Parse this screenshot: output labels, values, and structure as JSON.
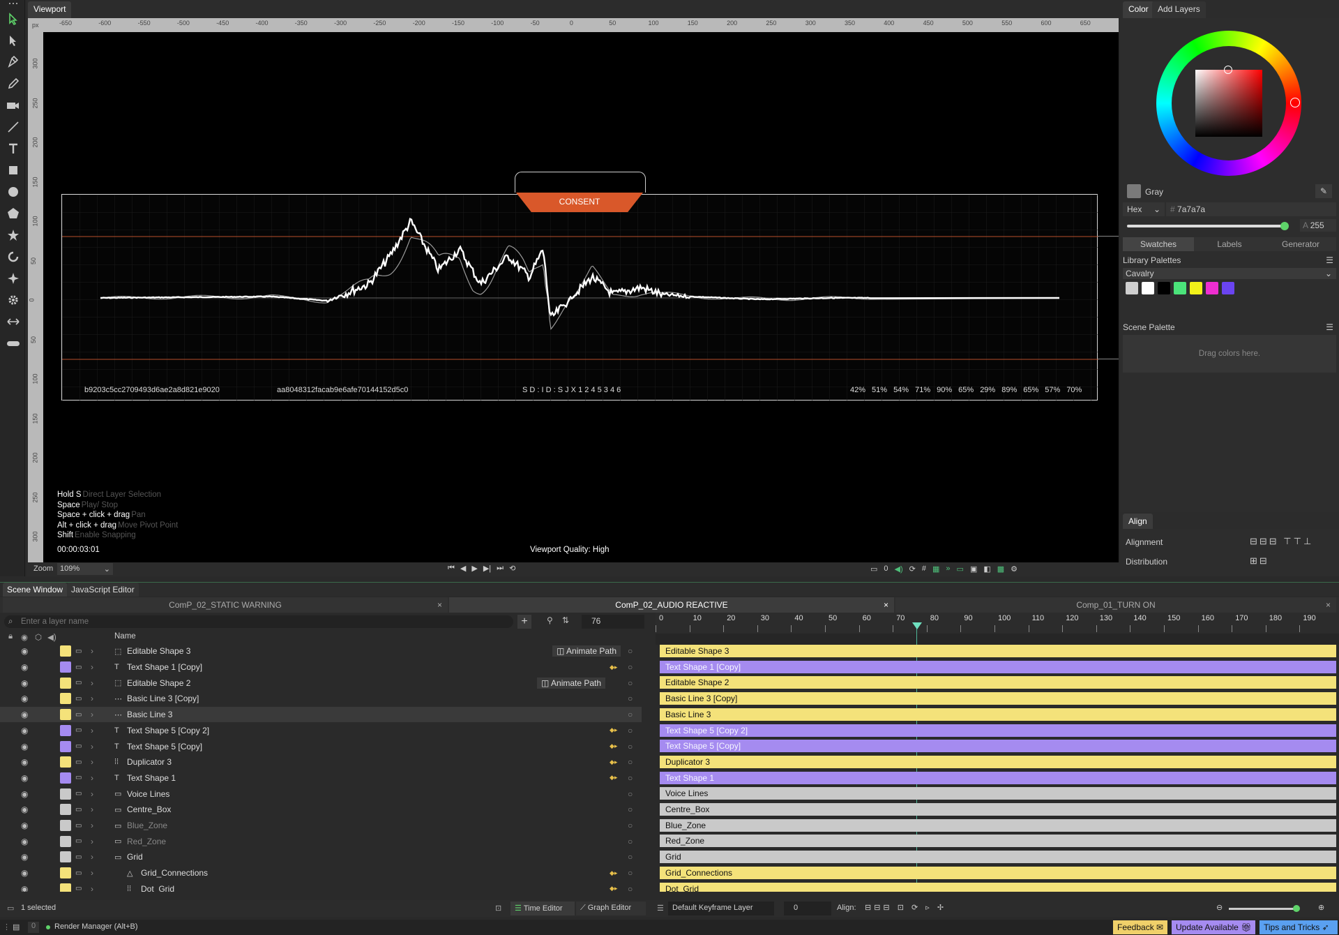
{
  "viewport": {
    "tab": "Viewport",
    "unit": "px",
    "ruler_h": [
      "-650",
      "-600",
      "-550",
      "-500",
      "-450",
      "-400",
      "-350",
      "-300",
      "-250",
      "-200",
      "-150",
      "-100",
      "-50",
      "0",
      "50",
      "100",
      "150",
      "200",
      "250",
      "300",
      "350",
      "400",
      "450",
      "500",
      "550",
      "600",
      "650"
    ],
    "ruler_v": [
      "300",
      "250",
      "200",
      "150",
      "100",
      "50",
      "0",
      "50",
      "100",
      "150",
      "200",
      "250",
      "300"
    ],
    "consent_label": "CONSENT",
    "hash_1": "b9203c5cc2709493d6ae2a8d821e9020",
    "hash_2": "aa8048312facab9e6afe70144152d5c0",
    "sd_id": "S D : I D : S J X 1 2 4 5 3 4 6",
    "percentages": [
      "42%",
      "51%",
      "54%",
      "71%",
      "90%",
      "65%",
      "29%",
      "89%",
      "65%",
      "57%",
      "70%"
    ],
    "hints": [
      {
        "key": "Hold S",
        "desc": "Direct Layer Selection"
      },
      {
        "key": "Space",
        "desc": "Play/ Stop"
      },
      {
        "key": "Space + click + drag",
        "desc": "Pan"
      },
      {
        "key": "Alt + click + drag",
        "desc": "Move Pivot Point"
      },
      {
        "key": "Shift",
        "desc": "Enable Snapping"
      }
    ],
    "timecode": "00:00:03:01",
    "quality": "Viewport Quality: High",
    "zoom_label": "Zoom",
    "zoom_value": "109%",
    "frame_value": "0"
  },
  "color_panel": {
    "tabs": [
      "Color",
      "Add Layers"
    ],
    "color_name": "Gray",
    "hex_label": "Hex",
    "hex_value": "7a7a7a",
    "hex_prefix": "#",
    "alpha_label": "A",
    "alpha_value": "255",
    "subtabs": [
      "Swatches",
      "Labels",
      "Generator"
    ],
    "library_palettes": "Library Palettes",
    "palette_name": "Cavalry",
    "swatch_colors": [
      "#cfcfcf",
      "#ffffff",
      "#000000",
      "#4be37a",
      "#f2f21a",
      "#ee2ed0",
      "#6a44f0"
    ],
    "scene_palette": "Scene Palette",
    "drag_hint": "Drag colors here.",
    "accent": "#e85f2c"
  },
  "align_panel": {
    "tab": "Align",
    "alignment": "Alignment",
    "distribution": "Distribution"
  },
  "bottom": {
    "tabs": [
      "Scene Window",
      "JavaScript Editor"
    ],
    "comp_tabs": [
      "ComP_02_STATIC WARNING",
      "ComP_02_AUDIO REACTIVE",
      "Comp_01_TURN ON"
    ],
    "search_placeholder": "Enter a layer name",
    "frame_field": "76",
    "name_header": "Name",
    "timeline_ticks": [
      "0",
      "10",
      "20",
      "30",
      "40",
      "50",
      "60",
      "70",
      "80",
      "90",
      "100",
      "110",
      "120",
      "130",
      "140",
      "150",
      "160",
      "170",
      "180",
      "190"
    ],
    "animate_path": "Animate Path",
    "layers": [
      {
        "name": "Editable Shape 3",
        "color": "y",
        "icon": "shape",
        "extra": "Animate Path"
      },
      {
        "name": "Text Shape 1 [Copy]",
        "color": "p",
        "icon": "text"
      },
      {
        "name": "Editable Shape 2",
        "color": "y",
        "icon": "shape",
        "extra": "Animate Path"
      },
      {
        "name": "Basic Line 3 [Copy]",
        "color": "y",
        "icon": "line"
      },
      {
        "name": "Basic Line 3",
        "color": "y",
        "icon": "line"
      },
      {
        "name": "Text Shape 5 [Copy 2]",
        "color": "p",
        "icon": "text"
      },
      {
        "name": "Text Shape 5 [Copy]",
        "color": "p",
        "icon": "text"
      },
      {
        "name": "Duplicator 3",
        "color": "y",
        "icon": "dup"
      },
      {
        "name": "Text Shape 1",
        "color": "p",
        "icon": "text"
      },
      {
        "name": "Voice Lines",
        "color": "g",
        "icon": "folder"
      },
      {
        "name": "Centre_Box",
        "color": "g",
        "icon": "folder"
      },
      {
        "name": "Blue_Zone",
        "color": "g",
        "icon": "folder"
      },
      {
        "name": "Red_Zone",
        "color": "g",
        "icon": "folder"
      },
      {
        "name": "Grid",
        "color": "g",
        "icon": "folder"
      },
      {
        "name": "Grid_Connections",
        "color": "y",
        "icon": "conn"
      },
      {
        "name": "Dot_Grid",
        "color": "y",
        "icon": "dup"
      }
    ],
    "selected_count": "1 selected",
    "time_editor": "Time Editor",
    "graph_editor": "Graph Editor",
    "keyframe_layer": "Default Keyframe Layer",
    "keyframe_value": "0",
    "align_label": "Align:"
  },
  "status": {
    "count": "0",
    "render_manager": "Render Manager (Alt+B)",
    "feedback": "Feedback",
    "update": "Update Available",
    "tips": "Tips and Tricks"
  }
}
